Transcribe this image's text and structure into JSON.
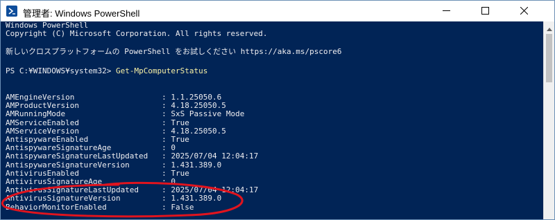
{
  "window": {
    "title": "管理者: Windows PowerShell",
    "minimize_glyph": "—",
    "maximize_glyph": "☐",
    "close_glyph": "✕"
  },
  "console": {
    "banner": [
      "Windows PowerShell",
      "Copyright (C) Microsoft Corporation. All rights reserved.",
      "新しいクロスプラットフォームの PowerShell をお試しください https://aka.ms/pscore6"
    ],
    "prompt": "PS C:¥WINDOWS¥system32>",
    "command": "Get-MpComputerStatus",
    "properties": [
      {
        "name": "AMEngineVersion",
        "value": "1.1.25050.6"
      },
      {
        "name": "AMProductVersion",
        "value": "4.18.25050.5"
      },
      {
        "name": "AMRunningMode",
        "value": "SxS Passive Mode"
      },
      {
        "name": "AMServiceEnabled",
        "value": "True"
      },
      {
        "name": "AMServiceVersion",
        "value": "4.18.25050.5"
      },
      {
        "name": "AntispywareEnabled",
        "value": "True"
      },
      {
        "name": "AntispywareSignatureAge",
        "value": "0"
      },
      {
        "name": "AntispywareSignatureLastUpdated",
        "value": "2025/07/04 12:04:17"
      },
      {
        "name": "AntispywareSignatureVersion",
        "value": "1.431.389.0"
      },
      {
        "name": "AntivirusEnabled",
        "value": "True"
      },
      {
        "name": "AntivirusSignatureAge",
        "value": "0"
      },
      {
        "name": "AntivirusSignatureLastUpdated",
        "value": "2025/07/04 12:04:17"
      },
      {
        "name": "AntivirusSignatureVersion",
        "value": "1.431.389.0"
      },
      {
        "name": "BehaviorMonitorEnabled",
        "value": "False"
      }
    ]
  },
  "colors": {
    "console_background": "#012456",
    "console_text": "#eeedf0",
    "command_text": "#f9f1a5",
    "annotation": "#e0141e"
  },
  "annotation": {
    "shape": "hand-drawn ellipse",
    "target": "AntivirusSignatureVersion"
  }
}
